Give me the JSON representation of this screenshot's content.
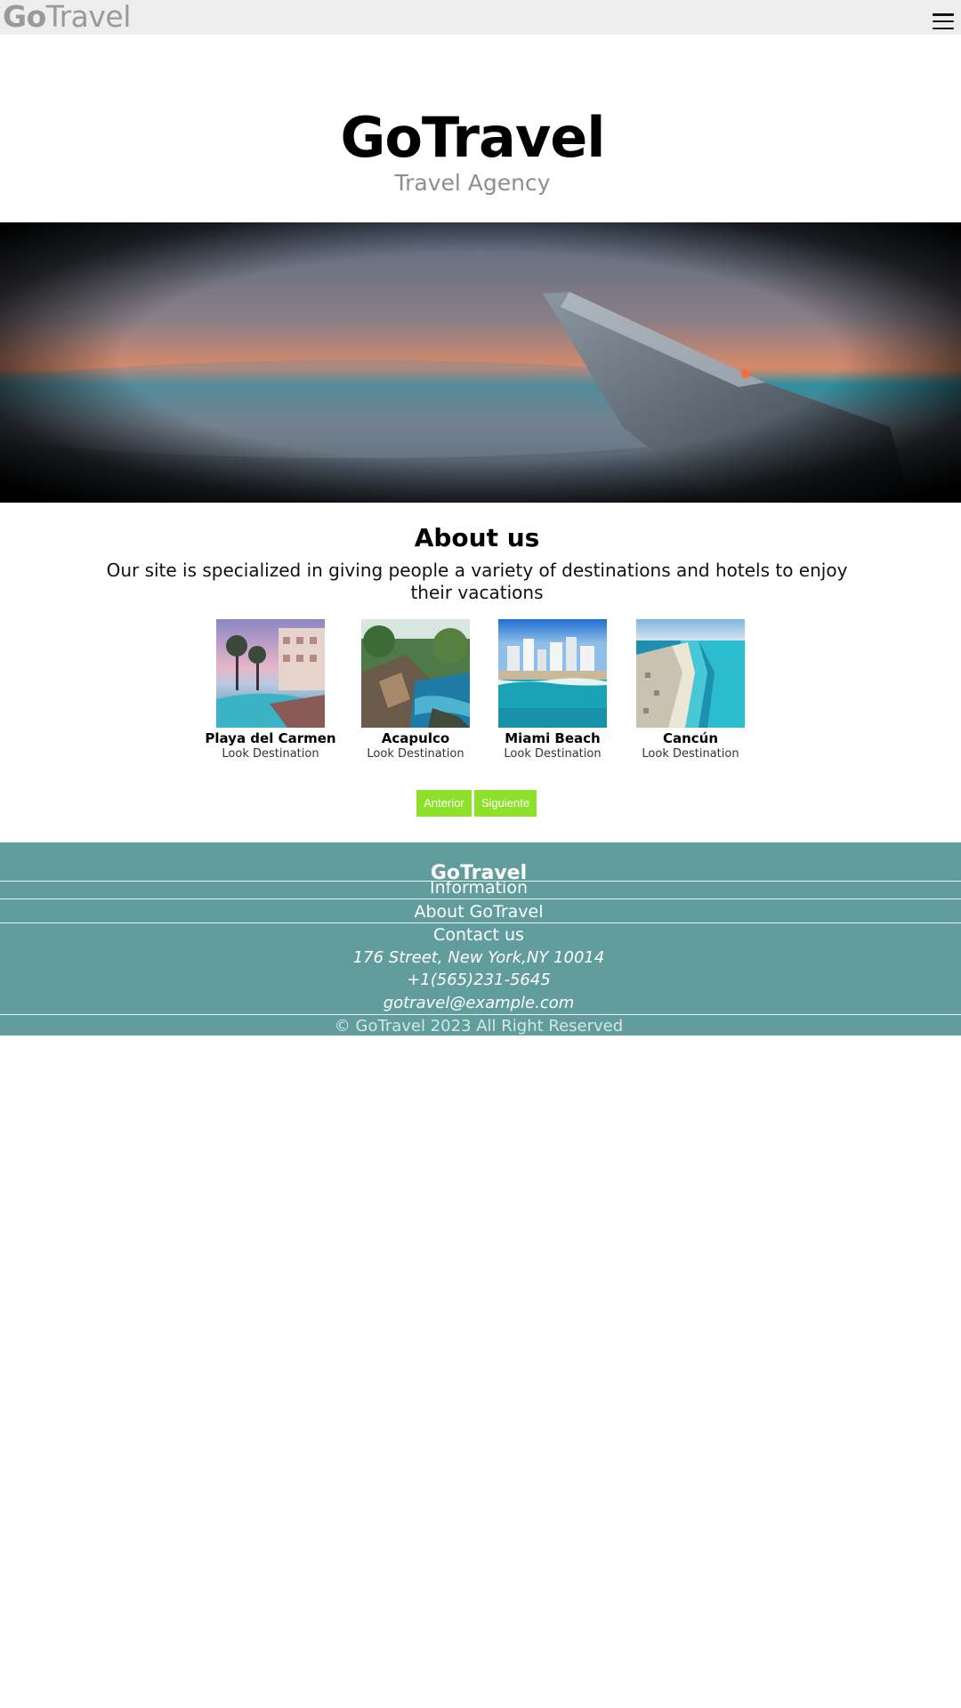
{
  "header": {
    "logo_go": "Go",
    "logo_rest": "Travel",
    "menu_icon": "hamburger-menu-icon"
  },
  "hero": {
    "title": "GoTravel",
    "subtitle": "Travel Agency"
  },
  "about": {
    "title": "About us",
    "text": "Our site is specialized in giving people a variety of destinations and hotels to enjoy their vacations"
  },
  "destinations": [
    {
      "name": "Playa del Carmen",
      "link": "Look Destination"
    },
    {
      "name": "Acapulco",
      "link": "Look Destination"
    },
    {
      "name": "Miami Beach",
      "link": "Look Destination"
    },
    {
      "name": "Cancún",
      "link": "Look Destination"
    }
  ],
  "pager": {
    "prev_label": "Anterior",
    "next_label": "Siguiente"
  },
  "footer": {
    "brand": "GoTravel",
    "information": "Information",
    "about_link": "About GoTravel",
    "contact": "Contact us",
    "address": "176 Street, New York,NY 10014",
    "phone": "+1(565)231-5645",
    "email": "gotravel@example.com",
    "copyright": "© GoTravel 2023 All Right Reserved"
  },
  "colors": {
    "topbar": "#eeeeee",
    "footer": "#619d9c",
    "button": "#8de12b"
  }
}
